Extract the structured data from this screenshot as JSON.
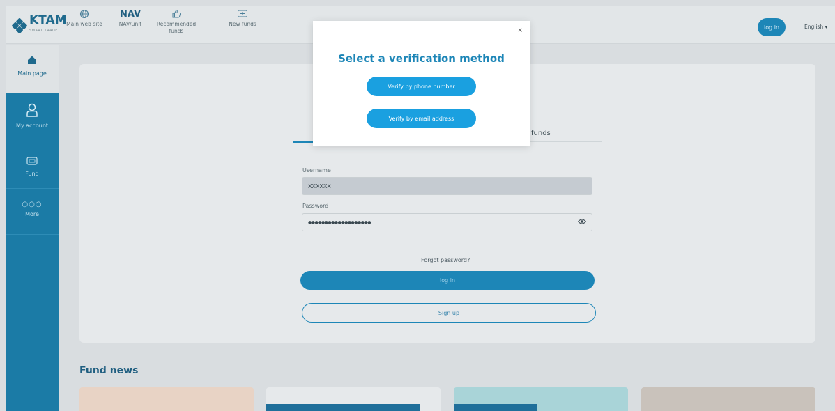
{
  "header": {
    "logo_text": "KTAM",
    "logo_sub": "SMART TRADE",
    "nav": [
      {
        "icon": "globe-icon",
        "label": "Main web site"
      },
      {
        "icon": "nav-text",
        "big": "NAV",
        "label": "NAV/unit"
      },
      {
        "icon": "thumbs-up-icon",
        "label": "Recommended funds"
      },
      {
        "icon": "new-fund-icon",
        "label": "New funds"
      }
    ],
    "login_label": "log in",
    "language": "English ▾"
  },
  "sidebar": {
    "items": [
      {
        "icon": "home-icon",
        "label": "Main page"
      },
      {
        "icon": "user-icon",
        "label": "My account"
      },
      {
        "icon": "fund-icon",
        "label": "Fund"
      },
      {
        "icon": "more-icon",
        "label": "More"
      }
    ]
  },
  "login_form": {
    "tab_funds": "funds",
    "username_label": "Username",
    "username_value": "XXXXXX",
    "password_label": "Password",
    "password_value": "●●●●●●●●●●●●●●●●●●●",
    "forgot": "Forgot password?",
    "login_button": "log in",
    "signup_button": "Sign up"
  },
  "news": {
    "title": "Fund news"
  },
  "modal": {
    "close": "×",
    "title": "Select a verification method",
    "phone_button": "Verify by phone number",
    "email_button": "Verify by email address"
  },
  "colors": {
    "primary": "#1d86b7",
    "modal_button": "#1aa0e0",
    "sidebar": "#1b7ba6"
  }
}
